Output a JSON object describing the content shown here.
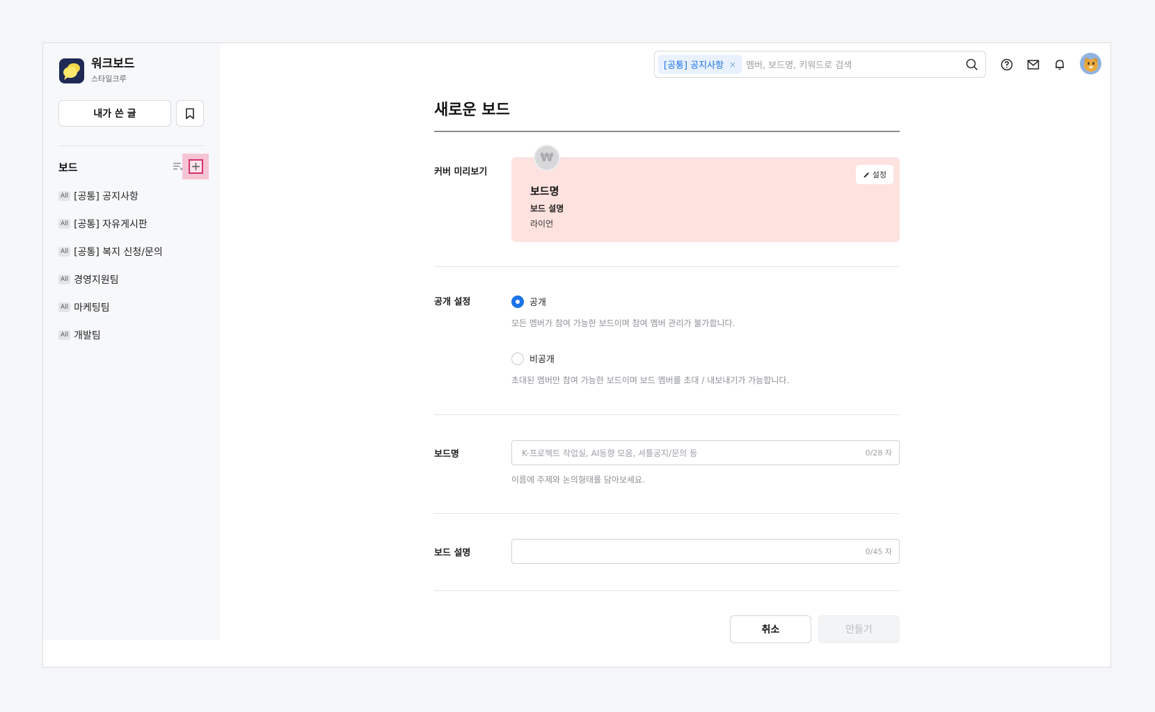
{
  "sidebar": {
    "brand_name": "워크보드",
    "brand_sub": "스타일크루",
    "my_posts_label": "내가 쓴 글",
    "boards_heading": "보드",
    "items": [
      {
        "badge": "All",
        "label": "[공통] 공지사항"
      },
      {
        "badge": "All",
        "label": "[공통] 자유게시판"
      },
      {
        "badge": "All",
        "label": "[공통] 복지 신청/문의"
      },
      {
        "badge": "All",
        "label": "경영지원팀"
      },
      {
        "badge": "All",
        "label": "마케팅팀"
      },
      {
        "badge": "All",
        "label": "개발팀"
      }
    ]
  },
  "search": {
    "chip_label": "[공통] 공지사항",
    "chip_remove": "×",
    "placeholder": "멤버, 보드명, 키워드로 검색"
  },
  "form": {
    "title": "새로운 보드",
    "cover_label": "커버 미리보기",
    "cover": {
      "icon_glyph": "₩",
      "settings_label": "설정",
      "name": "보드명",
      "desc": "보드 설명",
      "owner": "라이언"
    },
    "visibility_label": "공개 설정",
    "public_label": "공개",
    "public_help": "모든 멤버가 참여 가능한 보드이며 참여 멤버 관리가 불가합니다.",
    "private_label": "비공개",
    "private_help": "초대된 멤버만 참여 가능한 보드이며 보드 멤버를 초대 / 내보내기가 가능합니다.",
    "selected": "public",
    "name_label": "보드명",
    "name_placeholder": "K-프로젝트 작업실, AI동향 모음, 셔틀공지/문의 등",
    "name_count": "0/28 자",
    "name_help": "이름에 주제와 논의형태를 담아보세요.",
    "desc_label": "보드 설명",
    "desc_count": "0/45 자",
    "cancel_label": "취소",
    "create_label": "만들기"
  },
  "colors": {
    "accent": "#1a73e8",
    "cover_bg": "#fde2df",
    "highlight": "#d63070"
  }
}
